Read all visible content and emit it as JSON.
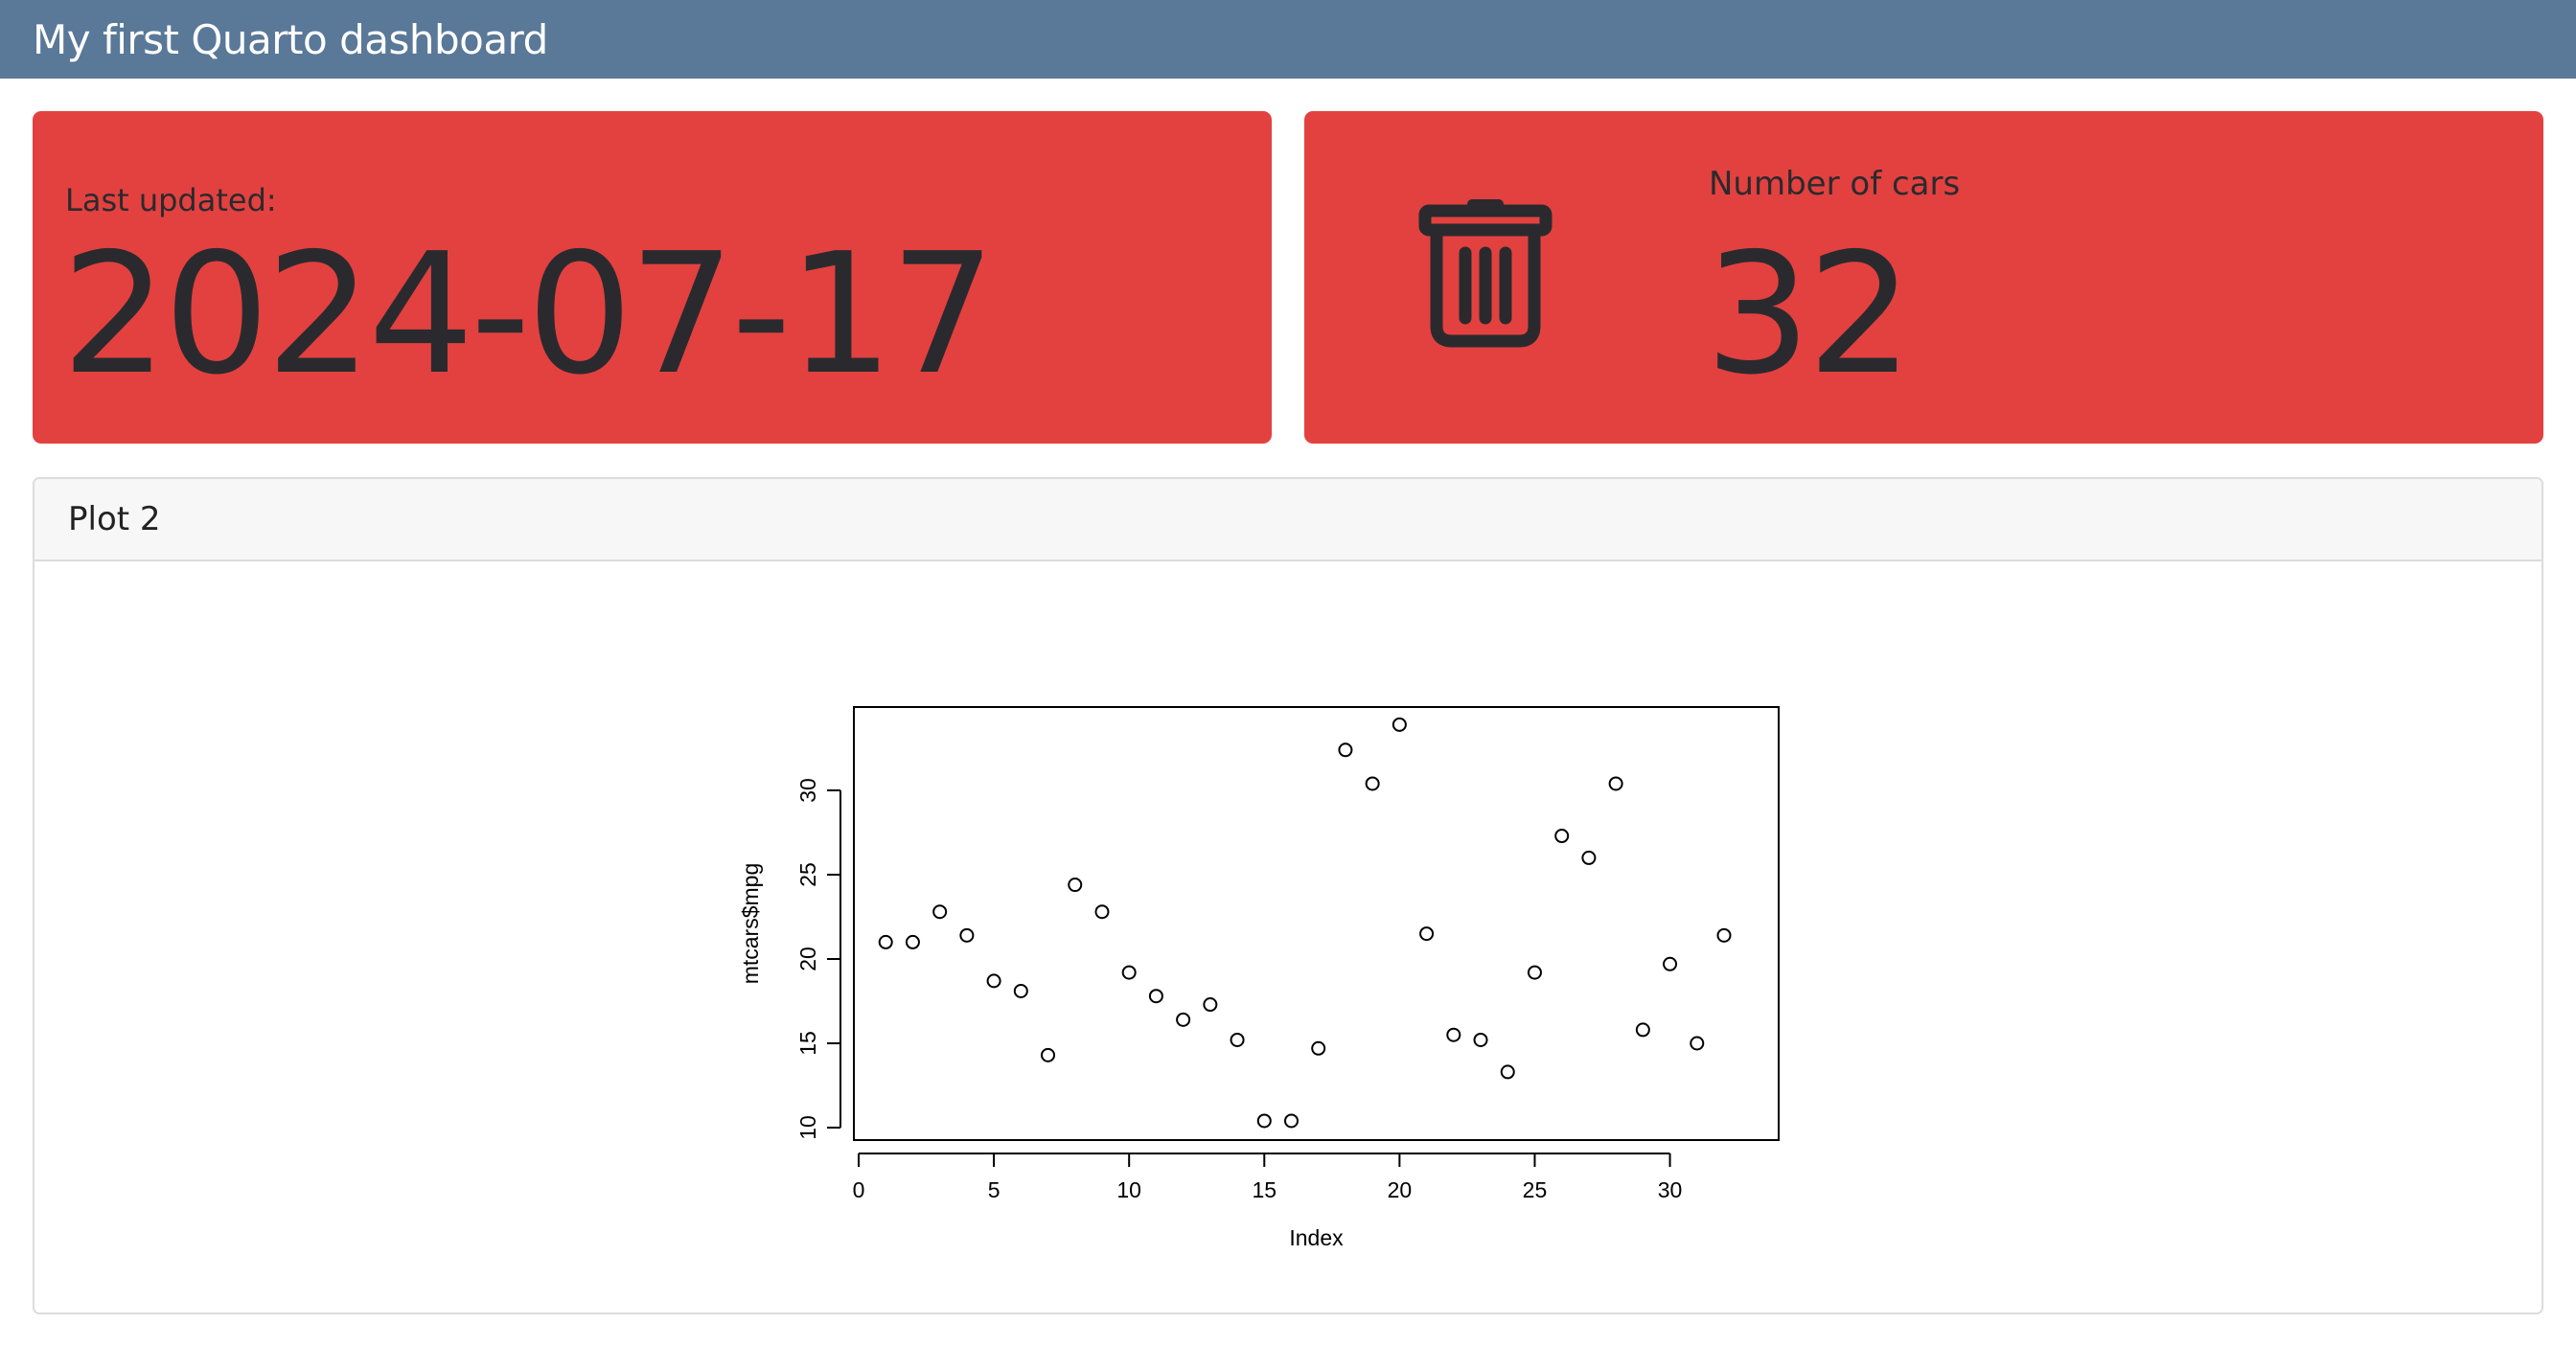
{
  "app": {
    "title": "My first Quarto dashboard"
  },
  "colors": {
    "navbar": "#5a7898",
    "valuebox": "#e2413f",
    "text_dark": "#2a2a2e"
  },
  "value_boxes": [
    {
      "label": "Last updated:",
      "value": "2024-07-17",
      "icon": ""
    },
    {
      "label": "Number of cars",
      "value": "32",
      "icon": "trash-icon"
    }
  ],
  "card": {
    "title": "Plot 2"
  },
  "chart_data": {
    "type": "scatter",
    "title": "",
    "xlabel": "Index",
    "ylabel": "mtcars$mpg",
    "xlim": [
      0,
      32
    ],
    "ylim": [
      10,
      34
    ],
    "xticks": [
      0,
      5,
      10,
      15,
      20,
      25,
      30
    ],
    "yticks": [
      10,
      15,
      20,
      25,
      30
    ],
    "grid": false,
    "marker": "open-circle",
    "x": [
      1,
      2,
      3,
      4,
      5,
      6,
      7,
      8,
      9,
      10,
      11,
      12,
      13,
      14,
      15,
      16,
      17,
      18,
      19,
      20,
      21,
      22,
      23,
      24,
      25,
      26,
      27,
      28,
      29,
      30,
      31,
      32
    ],
    "y": [
      21.0,
      21.0,
      22.8,
      21.4,
      18.7,
      18.1,
      14.3,
      24.4,
      22.8,
      19.2,
      17.8,
      16.4,
      17.3,
      15.2,
      10.4,
      10.4,
      14.7,
      32.4,
      30.4,
      33.9,
      21.5,
      15.5,
      15.2,
      13.3,
      19.2,
      27.3,
      26.0,
      30.4,
      15.8,
      19.7,
      15.0,
      21.4
    ]
  }
}
